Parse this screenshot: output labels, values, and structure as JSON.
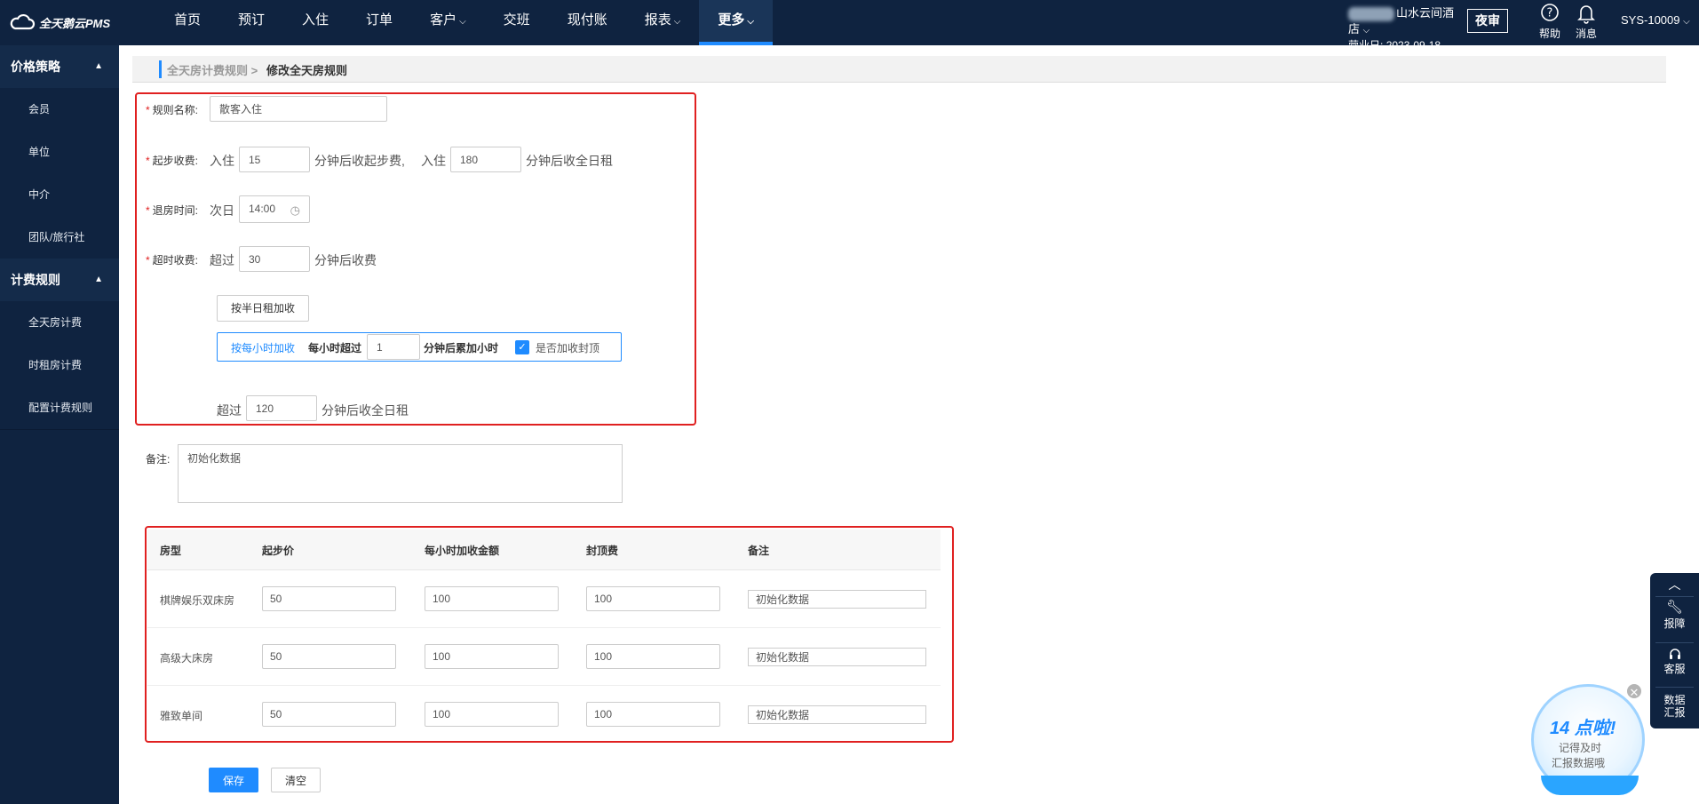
{
  "app": {
    "logo_text": "全天鹅云PMS"
  },
  "nav": [
    {
      "label": "首页",
      "chevron": false
    },
    {
      "label": "预订",
      "chevron": false
    },
    {
      "label": "入住",
      "chevron": false
    },
    {
      "label": "订单",
      "chevron": false
    },
    {
      "label": "客户",
      "chevron": true
    },
    {
      "label": "交班",
      "chevron": false
    },
    {
      "label": "现付账",
      "chevron": false
    },
    {
      "label": "报表",
      "chevron": true
    },
    {
      "label": "更多",
      "chevron": true,
      "active": true
    }
  ],
  "header": {
    "hotel_name": "山水云间酒店",
    "business_date_label": "营业日:",
    "business_date": "2023-09-18",
    "night_audit": "夜审",
    "help": "帮助",
    "messages": "消息",
    "user": "SYS-10009"
  },
  "sidebar": {
    "groups": [
      {
        "title": "价格策略",
        "items": [
          "会员",
          "单位",
          "中介",
          "团队/旅行社"
        ]
      },
      {
        "title": "计费规则",
        "items": [
          "全天房计费",
          "时租房计费",
          "配置计费规则"
        ]
      }
    ]
  },
  "breadcrumb": {
    "parent": "全天房计费规则 >",
    "current": "修改全天房规则"
  },
  "form": {
    "rule_name_label": "规则名称:",
    "rule_name": "散客入住",
    "start_fee_label": "起步收费:",
    "checkin_text": "入住",
    "start_minutes": "15",
    "start_after": "分钟后收起步费,",
    "checkin_text2": "入住",
    "full_minutes": "180",
    "full_after": "分钟后收全日租",
    "checkout_label": "退房时间:",
    "next_day": "次日",
    "checkout_time": "14:00",
    "overtime_label": "超时收费:",
    "exceed": "超过",
    "overtime_minutes": "30",
    "overtime_after": "分钟后收费",
    "half_day_button": "按半日租加收",
    "hourly_tag": "按每小时加收",
    "hourly_exceed": "每小时超过",
    "hourly_minutes": "1",
    "hourly_after": "分钟后累加小时",
    "cap_checkbox": "是否加收封顶",
    "exceed2": "超过",
    "full_day_minutes": "120",
    "full_day_after": "分钟后收全日租",
    "remarks_label": "备注:",
    "remarks": "初始化数据"
  },
  "table": {
    "headers": [
      "房型",
      "起步价",
      "每小时加收金额",
      "封顶费",
      "备注"
    ],
    "rows": [
      {
        "room": "棋牌娱乐双床房",
        "start": "50",
        "hourly": "100",
        "cap": "100",
        "note": "初始化数据"
      },
      {
        "room": "高级大床房",
        "start": "50",
        "hourly": "100",
        "cap": "100",
        "note": "初始化数据"
      },
      {
        "room": "雅致单间",
        "start": "50",
        "hourly": "100",
        "cap": "100",
        "note": "初始化数据"
      }
    ]
  },
  "actions": {
    "save": "保存",
    "clear": "清空"
  },
  "float_bar": {
    "report": "报障",
    "service": "客服",
    "data1": "数据",
    "data2": "汇报"
  },
  "bubble": {
    "title": "14 点啦!",
    "line1": "记得及时",
    "line2": "汇报数据哦"
  },
  "colors": {
    "nav_bg": "#0f2340",
    "accent": "#1f8bff",
    "highlight_border": "#e02020"
  }
}
